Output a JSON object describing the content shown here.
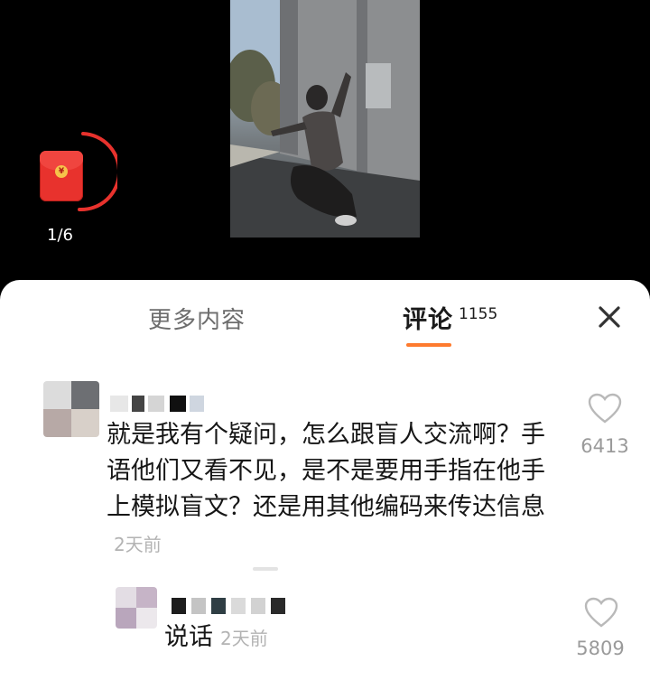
{
  "video": {
    "page_counter": "1/6",
    "redpacket_icon": "red-envelope-icon",
    "coin_glyph": "¥"
  },
  "sheet": {
    "tabs": [
      {
        "label": "更多内容",
        "active": false
      },
      {
        "label": "评论",
        "count": "1155",
        "active": true
      }
    ],
    "close_icon": "close-icon",
    "accent_color": "#fe7a2e"
  },
  "comments": [
    {
      "text": "就是我有个疑问，怎么跟盲人交流啊？手语他们又看不见，是不是要用手指在他手上模拟盲文？还是用其他编码来传达信息",
      "time": "2天前",
      "likes": "6413"
    },
    {
      "text": "说话",
      "time": "2天前",
      "likes": "5809"
    }
  ]
}
